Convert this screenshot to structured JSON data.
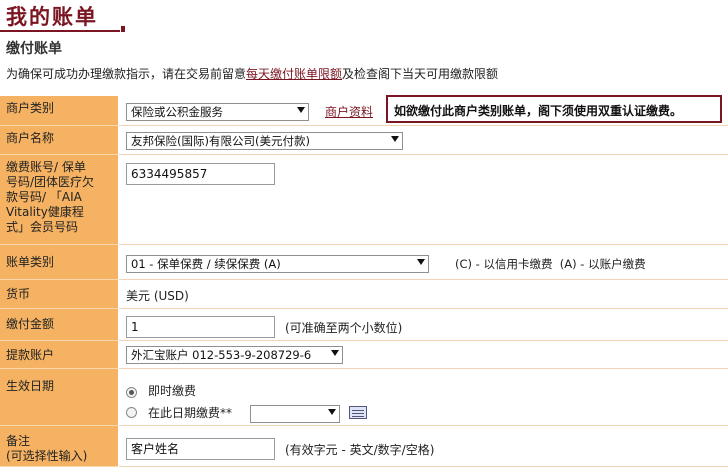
{
  "page": {
    "title": "我的账单",
    "subtitle": "缴付账单",
    "instruction_prefix": "为确保可成功办理缴款指示，请在交易前留意",
    "instruction_link": "每天缴付账单限额",
    "instruction_suffix": "及检查阁下当天可用缴款限额"
  },
  "form": {
    "merchant_type": {
      "label": "商户类别",
      "value": "保险或公积金服务",
      "link": "商户资料",
      "notice": "如欲缴付此商户类别账单，阁下须使用双重认证缴费。"
    },
    "merchant_name": {
      "label": "商户名称",
      "value": "友邦保险(国际)有限公司(美元付款)"
    },
    "account_number": {
      "label_lines": [
        "缴费账号/ 保单",
        "号码/团体医疗欠",
        "款号码/ 「AIA",
        "Vitality健康程",
        "式」会员号码"
      ],
      "value": "6334495857"
    },
    "bill_type": {
      "label": "账单类别",
      "value": "01 - 保单保费 / 续保保费 (A)",
      "note": "(C) - 以信用卡缴费  (A) - 以账户缴费"
    },
    "currency": {
      "label": "货币",
      "value": "美元 (USD)"
    },
    "amount": {
      "label": "缴付金额",
      "value": "1",
      "hint": "(可准确至两个小数位)"
    },
    "debit_account": {
      "label": "提款账户",
      "value": "外汇宝账户 012-553-9-208729-6"
    },
    "effective_date": {
      "label": "生效日期",
      "option_now": "即时缴费",
      "option_date": "在此日期缴费**",
      "date_value": ""
    },
    "remarks": {
      "label_lines": [
        "备注",
        "(可选择性输入)"
      ],
      "value": "客户姓名",
      "hint": "(有效字元 - 英文/数字/空格)"
    }
  },
  "colors": {
    "brand": "#7b1522",
    "label_bg": "#f5b262"
  }
}
